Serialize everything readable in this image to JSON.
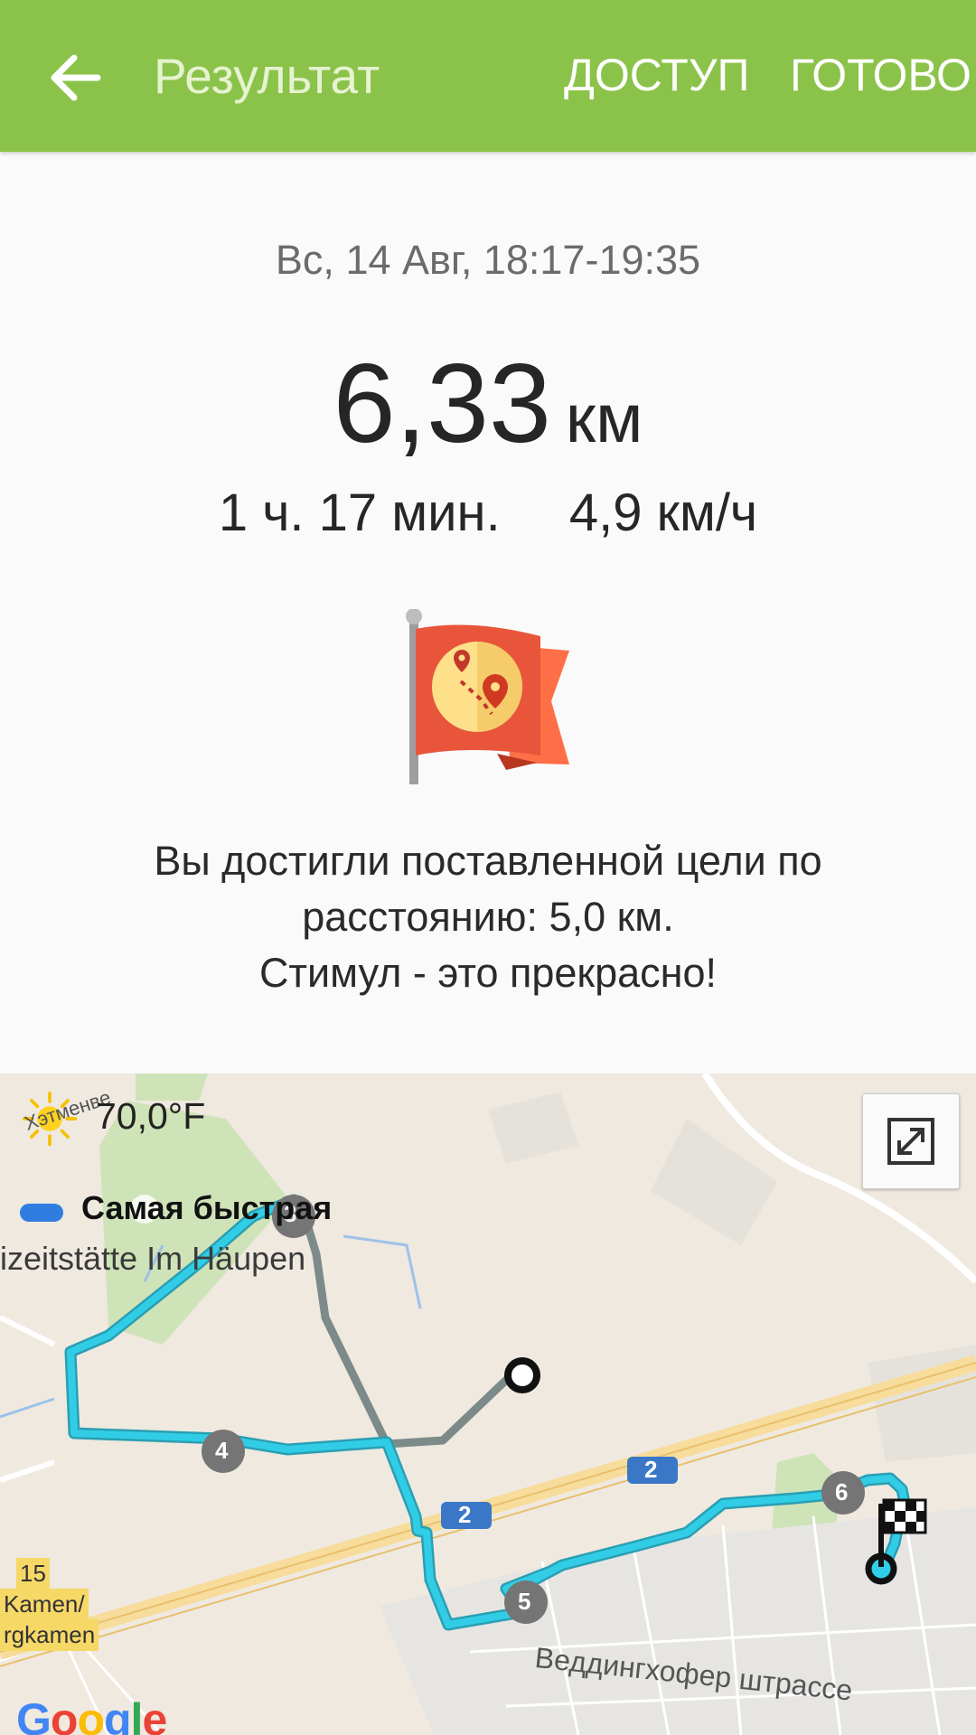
{
  "app_bar": {
    "title": "Результат",
    "share_label": "ДОСТУП",
    "done_label": "ГОТОВО",
    "color": "#8bc34a"
  },
  "summary": {
    "datetime": "Вс, 14 Авг, 18:17-19:35",
    "distance_value": "6,33",
    "distance_unit": "км",
    "duration": "1 ч. 17 мин.",
    "speed": "4,9 км/ч"
  },
  "achievement": {
    "icon": "goal-flag-icon",
    "line1": "Вы достигли поставленной цели по",
    "line2": "расстоянию: 5,0 км.",
    "line3": "Стимул - это прекрасно!"
  },
  "map": {
    "weather_icon": "sun-icon",
    "weather_temp": "70,0°F",
    "place_label_rotated": "Хэтменве",
    "legend_label": "Самая быстрая",
    "legend_color": "#2f7de1",
    "poi_label": "izeitstätte Im Häupen",
    "street_label": "Веддингхофер штрассе",
    "road_number_1": "2",
    "road_number_2": "2",
    "route_markers": [
      "4",
      "5",
      "6"
    ],
    "hidden_marker": "3",
    "yellow_tag_number": "15",
    "yellow_tag_line1": "Kamen/",
    "yellow_tag_line2": "rgkamen",
    "route_color": "#31cde6",
    "logo_text": "Google"
  }
}
